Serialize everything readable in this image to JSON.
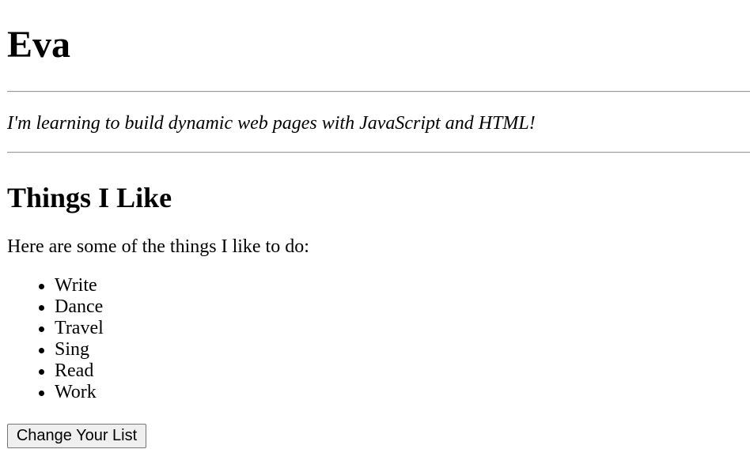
{
  "page": {
    "title": "Eva",
    "tagline": "I'm learning to build dynamic web pages with JavaScript and HTML!"
  },
  "likes_section": {
    "heading": "Things I Like",
    "intro": "Here are some of the things I like to do:",
    "items": [
      {
        "label": "Write"
      },
      {
        "label": "Dance"
      },
      {
        "label": "Travel"
      },
      {
        "label": "Sing"
      },
      {
        "label": "Read"
      },
      {
        "label": "Work"
      }
    ],
    "button_label": "Change Your List"
  }
}
